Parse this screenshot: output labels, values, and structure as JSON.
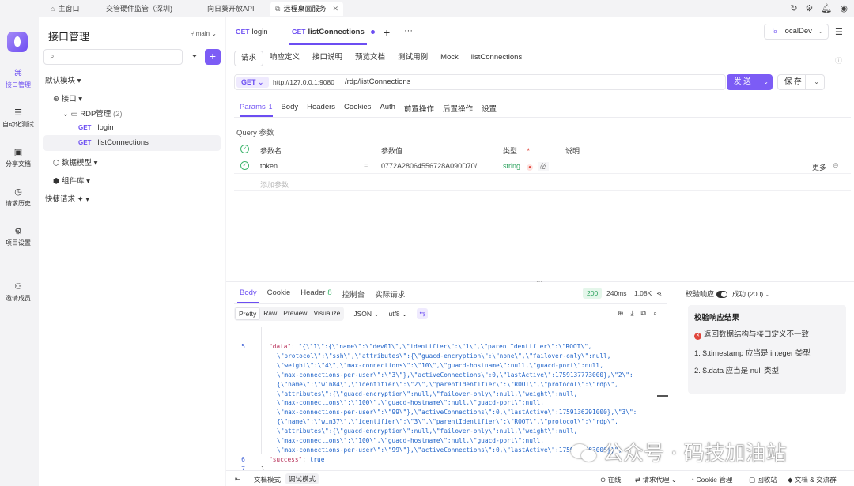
{
  "window_tabs": [
    {
      "icon": "home-icon",
      "label": "主窗口"
    },
    {
      "label": "交管硬件监管（深圳)"
    },
    {
      "label": "向日葵开放API"
    },
    {
      "icon": "external-icon",
      "label": "远程桌面服务",
      "active": true
    }
  ],
  "window_tabs_more": "···",
  "rail": [
    {
      "icon": "api-icon",
      "label": "接口管理",
      "active": true
    },
    {
      "icon": "auto-test-icon",
      "label": "自动化测试"
    },
    {
      "icon": "doc-share-icon",
      "label": "分享文档"
    },
    {
      "icon": "history-icon",
      "label": "请求历史"
    },
    {
      "icon": "settings-icon",
      "label": "项目设置"
    },
    {
      "icon": "invite-icon",
      "label": "邀请成员"
    }
  ],
  "sidebar": {
    "title": "接口管理",
    "branch": "main",
    "search_placeholder": "",
    "default_module": "默认模块",
    "tree": {
      "root": "接口",
      "folder": "RDP管理",
      "folder_count": "(2)",
      "items": [
        {
          "method": "GET",
          "name": "login"
        },
        {
          "method": "GET",
          "name": "listConnections"
        }
      ],
      "data_model": "数据模型",
      "components": "组件库",
      "quick_request": "快捷请求"
    }
  },
  "request_tabs": [
    {
      "method": "GET",
      "name": "login"
    },
    {
      "method": "GET",
      "name": "listConnections",
      "active": true
    }
  ],
  "env": "localDev",
  "sub_tabs": [
    "请求",
    "响应定义",
    "接口说明",
    "预览文档",
    "测试用例",
    "Mock",
    "listConnections"
  ],
  "url": {
    "method": "GET",
    "host": "http://127.0.0.1:9080",
    "path": "/rdp/listConnections",
    "send": "发 送",
    "save": "保 存"
  },
  "param_tabs": [
    {
      "label": "Params",
      "count": "1",
      "active": true
    },
    {
      "label": "Body"
    },
    {
      "label": "Headers"
    },
    {
      "label": "Cookies"
    },
    {
      "label": "Auth"
    },
    {
      "label": "前置操作"
    },
    {
      "label": "后置操作"
    },
    {
      "label": "设置"
    }
  ],
  "query_label": "Query 参数",
  "params_table": {
    "headers": {
      "name": "参数名",
      "value": "参数值",
      "type": "类型",
      "required_mark": "*",
      "desc": "说明"
    },
    "rows": [
      {
        "name": "token",
        "value": "0772A28064556728A090D70/",
        "type": "string",
        "flag": "必"
      }
    ],
    "more": "更多",
    "add_placeholder": "添加参数"
  },
  "response": {
    "tabs": [
      {
        "label": "Body",
        "active": true
      },
      {
        "label": "Cookie"
      },
      {
        "label": "Header",
        "count": "8"
      },
      {
        "label": "控制台"
      },
      {
        "label": "实际请求"
      }
    ],
    "status": "200",
    "time": "240ms",
    "size": "1.08K",
    "views": [
      "Pretty",
      "Raw",
      "Preview",
      "Visualize"
    ],
    "format": "JSON",
    "encoding": "utf8",
    "code": [
      {
        "ln": "5",
        "text": "\"data\": \"{\\\"1\\\":{\\\"name\\\":\\\"dev01\\\",\\\"identifier\\\":\\\"1\\\",\\\"parentIdentifier\\\":\\\"ROOT\\\","
      },
      {
        "ln": "",
        "text": "\\\"protocol\\\":\\\"ssh\\\",\\\"attributes\\\":{\\\"guacd-encryption\\\":\\\"none\\\",\\\"failover-only\\\":null,"
      },
      {
        "ln": "",
        "text": "\\\"weight\\\":\\\"4\\\",\\\"max-connections\\\":\\\"10\\\",\\\"guacd-hostname\\\":null,\\\"guacd-port\\\":null,"
      },
      {
        "ln": "",
        "text": "\\\"max-connections-per-user\\\":\\\"3\\\"},\\\"activeConnections\\\":0,\\\"lastActive\\\":1759137773000},\\\"2\\\":"
      },
      {
        "ln": "",
        "text": "{\\\"name\\\":\\\"win84\\\",\\\"identifier\\\":\\\"2\\\",\\\"parentIdentifier\\\":\\\"ROOT\\\",\\\"protocol\\\":\\\"rdp\\\","
      },
      {
        "ln": "",
        "text": "\\\"attributes\\\":{\\\"guacd-encryption\\\":null,\\\"failover-only\\\":null,\\\"weight\\\":null,"
      },
      {
        "ln": "",
        "text": "\\\"max-connections\\\":\\\"100\\\",\\\"guacd-hostname\\\":null,\\\"guacd-port\\\":null,"
      },
      {
        "ln": "",
        "text": "\\\"max-connections-per-user\\\":\\\"99\\\"},\\\"activeConnections\\\":0,\\\"lastActive\\\":1759136291000},\\\"3\\\":"
      },
      {
        "ln": "",
        "text": "{\\\"name\\\":\\\"win37\\\",\\\"identifier\\\":\\\"3\\\",\\\"parentIdentifier\\\":\\\"ROOT\\\",\\\"protocol\\\":\\\"rdp\\\","
      },
      {
        "ln": "",
        "text": "\\\"attributes\\\":{\\\"guacd-encryption\\\":null,\\\"failover-only\\\":null,\\\"weight\\\":null,"
      },
      {
        "ln": "",
        "text": "\\\"max-connections\\\":\\\"100\\\",\\\"guacd-hostname\\\":null,\\\"guacd-port\\\":null,"
      },
      {
        "ln": "",
        "text": "\\\"max-connections-per-user\\\":\\\"99\\\"},\\\"activeConnections\\\":0,\\\"lastActive\\\":1759137883000}}\","
      },
      {
        "ln": "6",
        "text": "\"success\": true"
      },
      {
        "ln": "7",
        "text": "}"
      }
    ]
  },
  "validation": {
    "label": "校验响应",
    "result": "成功 (200)",
    "title": "校验响应结果",
    "error": "返回数据结构与接口定义不一致",
    "items": [
      "1. $.timestamp 应当是 integer 类型",
      "2. $.data 应当是 null 类型"
    ]
  },
  "bottom": {
    "doc_mode": "文档模式",
    "debug_mode": "调试模式",
    "online": "在线",
    "proxy": "请求代理",
    "cookie": "Cookie 管理",
    "recycle": "回收站",
    "docs": "文档 & 交流群"
  },
  "watermark": "公众号 · 码技加油站",
  "colors": {
    "accent": "#7c5cf5",
    "success": "#2ea35f",
    "error": "#e0443a"
  }
}
